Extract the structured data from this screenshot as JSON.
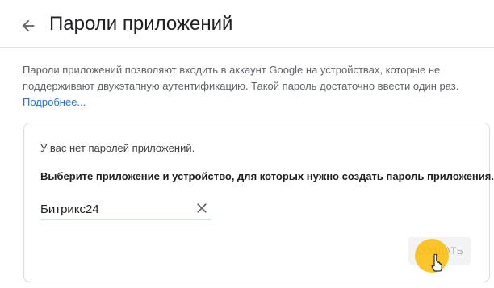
{
  "header": {
    "title": "Пароли приложений"
  },
  "intro": {
    "text": "Пароли приложений позволяют входить в аккаунт Google на устройствах, которые не поддерживают двухэтапную аутентификацию. Такой пароль достаточно ввести один раз.",
    "learn_more": "Подробнее..."
  },
  "card": {
    "no_passwords": "У вас нет паролей приложений.",
    "instruction": "Выберите приложение и устройство, для которых нужно создать пароль приложения.",
    "app_field": {
      "value": "Битрикс24"
    },
    "create_button": "СОЗДАТЬ"
  },
  "icons": {
    "back": "arrow-back-icon",
    "clear": "close-icon",
    "cursor": "hand-pointer-icon"
  },
  "colors": {
    "link": "#1a73e8",
    "title": "#202124",
    "body_text": "#5f6368",
    "click_highlight": "#fbbc05"
  }
}
